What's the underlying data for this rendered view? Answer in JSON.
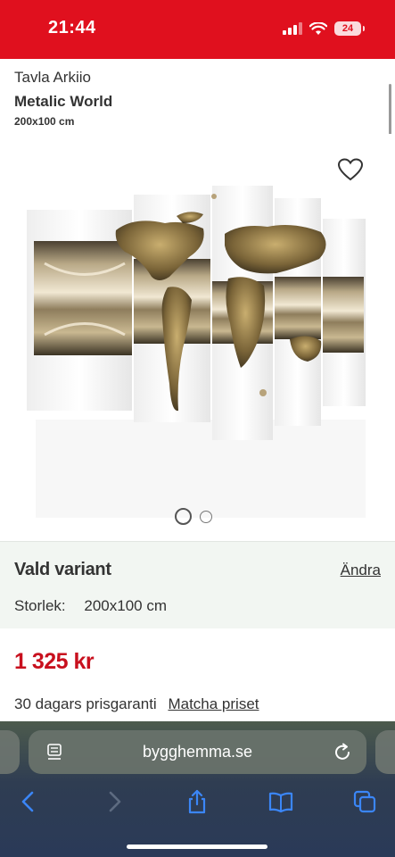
{
  "status_bar": {
    "time": "21:44",
    "battery": "24"
  },
  "product": {
    "brand": "Tavla Arkiio",
    "title": "Metalic World",
    "size": "200x100 cm",
    "image_pages": 2,
    "current_image": 1
  },
  "variant": {
    "heading": "Vald variant",
    "change_link": "Ändra",
    "size_label": "Storlek:",
    "size_value": "200x100 cm"
  },
  "price": {
    "amount": "1 325 kr",
    "guarantee": "30 dagars prisgaranti",
    "match_link": "Matcha priset"
  },
  "browser": {
    "url": "bygghemma.se",
    "toolbar": [
      "back-icon",
      "forward-icon",
      "share-icon",
      "bookmarks-icon",
      "tabs-icon"
    ]
  },
  "colors": {
    "brand_red": "#e0101e",
    "price_red": "#c8101e",
    "variant_bg": "#f2f6f2"
  }
}
